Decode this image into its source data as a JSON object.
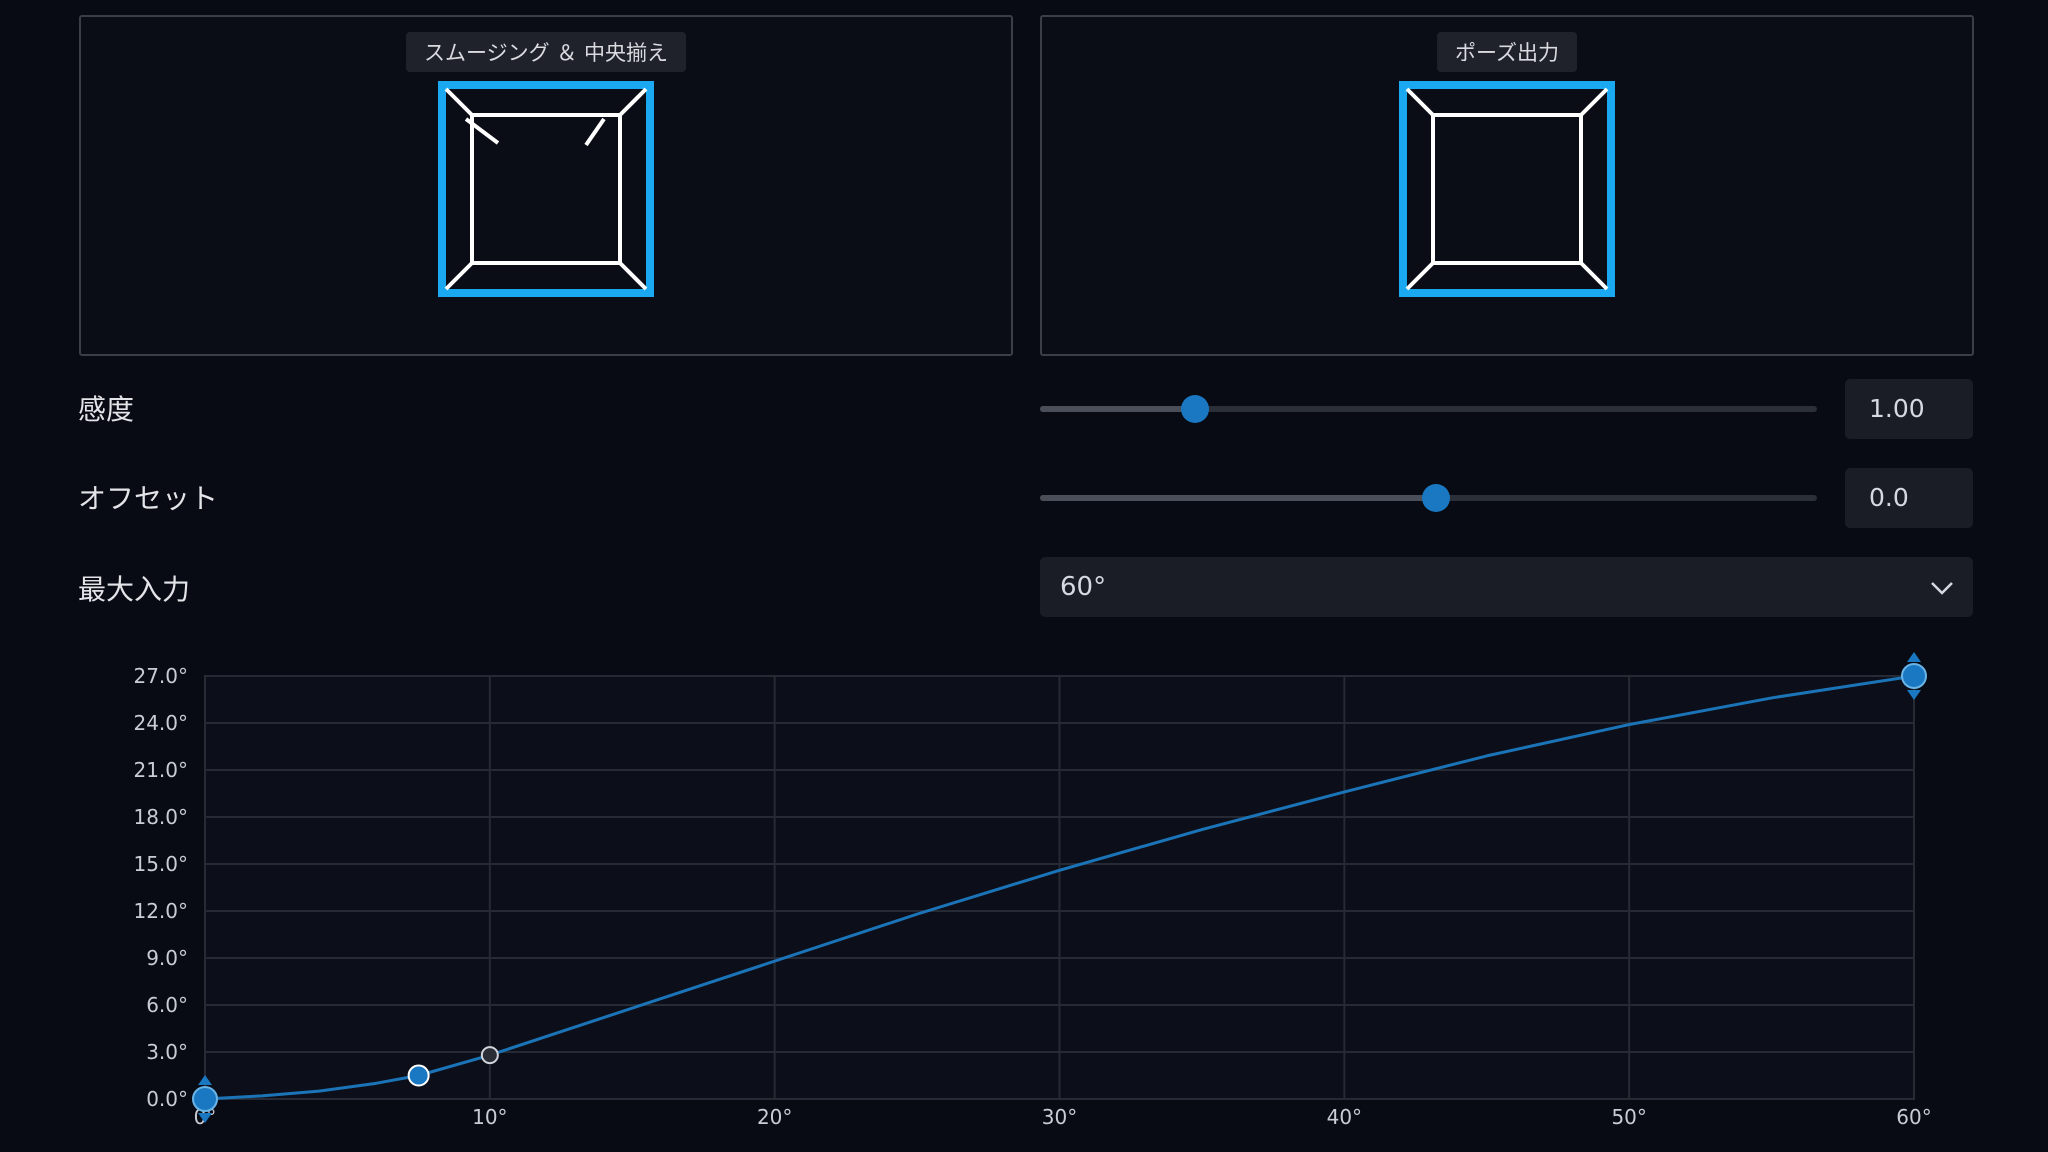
{
  "panels": {
    "smoothing": {
      "label": "スムージング ＆ 中央揃え"
    },
    "pose": {
      "label": "ポーズ出力"
    }
  },
  "controls": {
    "sensitivity": {
      "label": "感度",
      "value": "1.00",
      "position": 0.2
    },
    "offset": {
      "label": "オフセット",
      "value": "0.0",
      "position": 0.51
    },
    "max_input": {
      "label": "最大入力",
      "selected": "60°"
    }
  },
  "colors": {
    "accent": "#1aa9f0",
    "curve": "#1b74b8",
    "thumb": "#1a78c2",
    "background": "#080b14"
  },
  "chart_data": {
    "type": "line",
    "x_ticks": [
      "0°",
      "10°",
      "20°",
      "30°",
      "40°",
      "50°",
      "60°"
    ],
    "y_ticks": [
      "0.0°",
      "3.0°",
      "6.0°",
      "9.0°",
      "12.0°",
      "15.0°",
      "18.0°",
      "21.0°",
      "24.0°",
      "27.0°"
    ],
    "xlim": [
      0,
      60
    ],
    "ylim": [
      0,
      27
    ],
    "grid": true,
    "series": [
      {
        "x": [
          0,
          2,
          4,
          6,
          7.5,
          10,
          15,
          20,
          25,
          30,
          35,
          40,
          45,
          50,
          55,
          60
        ],
        "y": [
          0,
          0.2,
          0.5,
          1.0,
          1.5,
          2.8,
          5.8,
          8.8,
          11.8,
          14.6,
          17.2,
          19.6,
          21.9,
          23.9,
          25.6,
          27.0
        ]
      }
    ],
    "control_points": [
      {
        "x": 0,
        "y": 0,
        "style": "endpoint"
      },
      {
        "x": 7.5,
        "y": 1.5,
        "style": "filled"
      },
      {
        "x": 10,
        "y": 2.8,
        "style": "hollow"
      },
      {
        "x": 60,
        "y": 27,
        "style": "endpoint"
      }
    ]
  }
}
